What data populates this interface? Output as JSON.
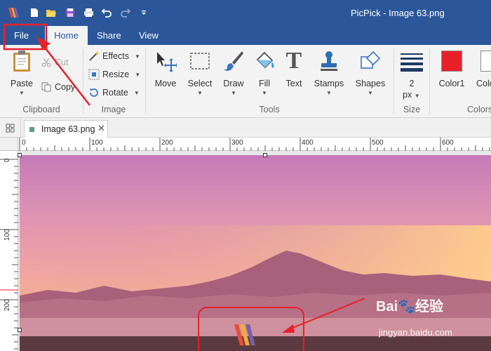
{
  "titlebar": {
    "title": "PicPick - Image 63.png",
    "quick_access": [
      "new-icon",
      "open-icon",
      "save-icon",
      "print-icon",
      "undo-icon",
      "redo-icon",
      "customize-icon"
    ]
  },
  "tabs": {
    "file": "File",
    "home": "Home",
    "share": "Share",
    "view": "View"
  },
  "ribbon": {
    "clipboard": {
      "paste": "Paste",
      "cut": "Cut",
      "copy": "Copy",
      "group": "Clipboard"
    },
    "image": {
      "effects": "Effects",
      "resize": "Resize",
      "rotate": "Rotate",
      "group": "Image"
    },
    "tools": {
      "move": "Move",
      "select": "Select",
      "draw": "Draw",
      "fill": "Fill",
      "text": "Text",
      "stamps": "Stamps",
      "shapes": "Shapes",
      "group": "Tools"
    },
    "size": {
      "value": "2",
      "unit": "px",
      "group": "Size"
    },
    "colors": {
      "color1": "Color1",
      "color2": "Colo",
      "group": "Colors",
      "color1_hex": "#e8202a",
      "color2_hex": "#ffffff"
    }
  },
  "document": {
    "tab_name": "Image 63.png"
  },
  "rulers": {
    "horizontal": [
      "0",
      "100",
      "200",
      "300",
      "400",
      "500",
      "600"
    ],
    "vertical": [
      "0",
      "100",
      "200"
    ]
  },
  "watermark": {
    "brand": "Bai",
    "brand2": "经验",
    "url": "jingyan.baidu.com"
  },
  "colors": {
    "titlebar": "#2b579a",
    "annotation": "#e8202a"
  }
}
